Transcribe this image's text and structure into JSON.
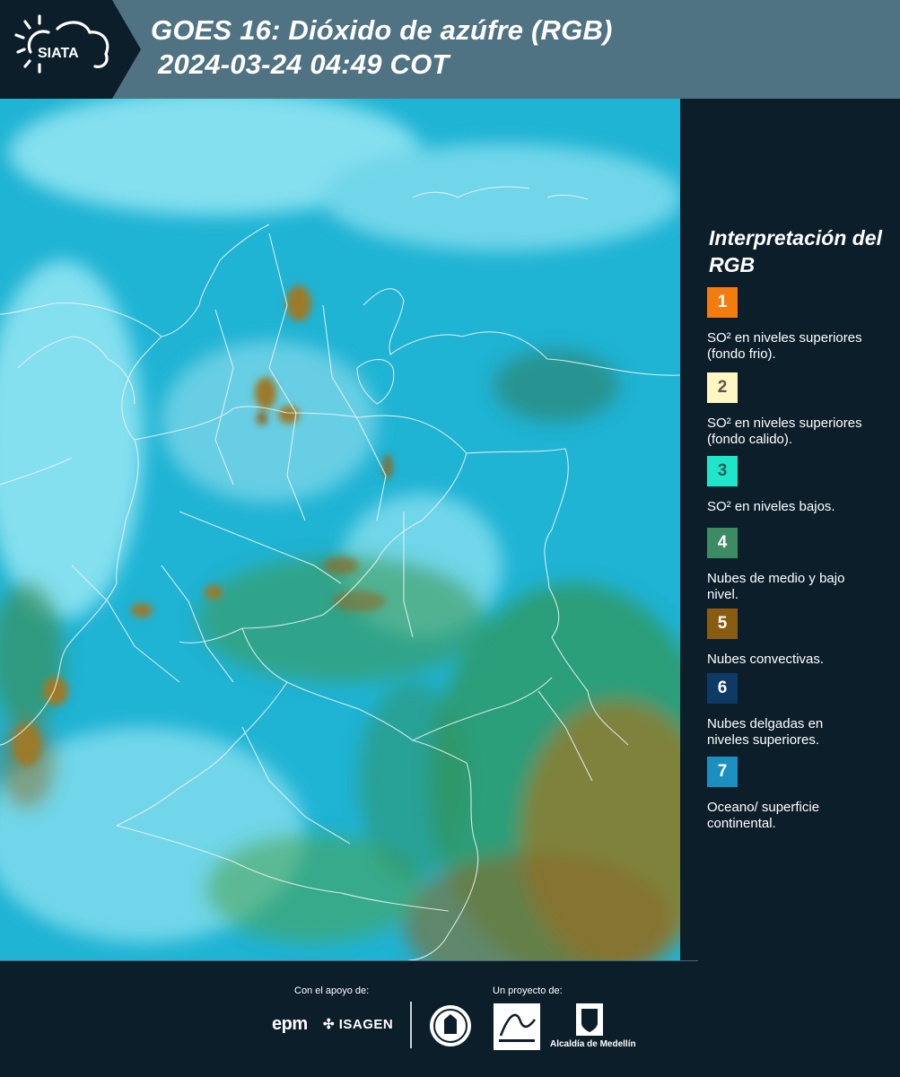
{
  "header": {
    "logo_text": "SIATA",
    "title_line1": "GOES 16: Dióxido de azúfre (RGB)",
    "title_line2": "2024-03-24 04:49 COT",
    "background_color": "#4f7382",
    "logo_chevron_color": "#0d1e2b"
  },
  "map": {
    "background_color": "#1fb3d4",
    "cloud_color": "#8fe4f2",
    "land_cloud_color": "#2f9a6a",
    "convective_color": "#9b7a2a",
    "border_color": "#e8f1f4"
  },
  "legend": {
    "title": "Interpretación del RGB",
    "items": [
      {
        "number": "1",
        "color": "#f47c0f",
        "number_color": "#ffffff",
        "description": "SO² en niveles superiores (fondo frio)."
      },
      {
        "number": "2",
        "color": "#fff6c2",
        "number_color": "#555555",
        "description": "SO² en niveles superiores (fondo calido)."
      },
      {
        "number": "3",
        "color": "#1fe6c8",
        "number_color": "#2a5b5a",
        "description": "SO² en niveles bajos."
      },
      {
        "number": "4",
        "color": "#3d8b63",
        "number_color": "#ffffff",
        "description": "Nubes de medio y bajo nivel."
      },
      {
        "number": "5",
        "color": "#8a5c12",
        "number_color": "#ffffff",
        "description": "Nubes convectivas."
      },
      {
        "number": "6",
        "color": "#0e3a66",
        "number_color": "#ffffff",
        "description": "Nubes delgadas en niveles superiores."
      },
      {
        "number": "7",
        "color": "#1a8fc0",
        "number_color": "#ffffff",
        "description": "Oceano/ superficie continental."
      }
    ]
  },
  "footer": {
    "support_label": "Con el apoyo de:",
    "project_label": "Un proyecto de:",
    "sponsors": [
      "epm",
      "ISAGEN"
    ],
    "partner_area": "Área Metropolitana Valle de Aburrá",
    "partner_alcaldia": "Alcaldía de Medellín"
  }
}
